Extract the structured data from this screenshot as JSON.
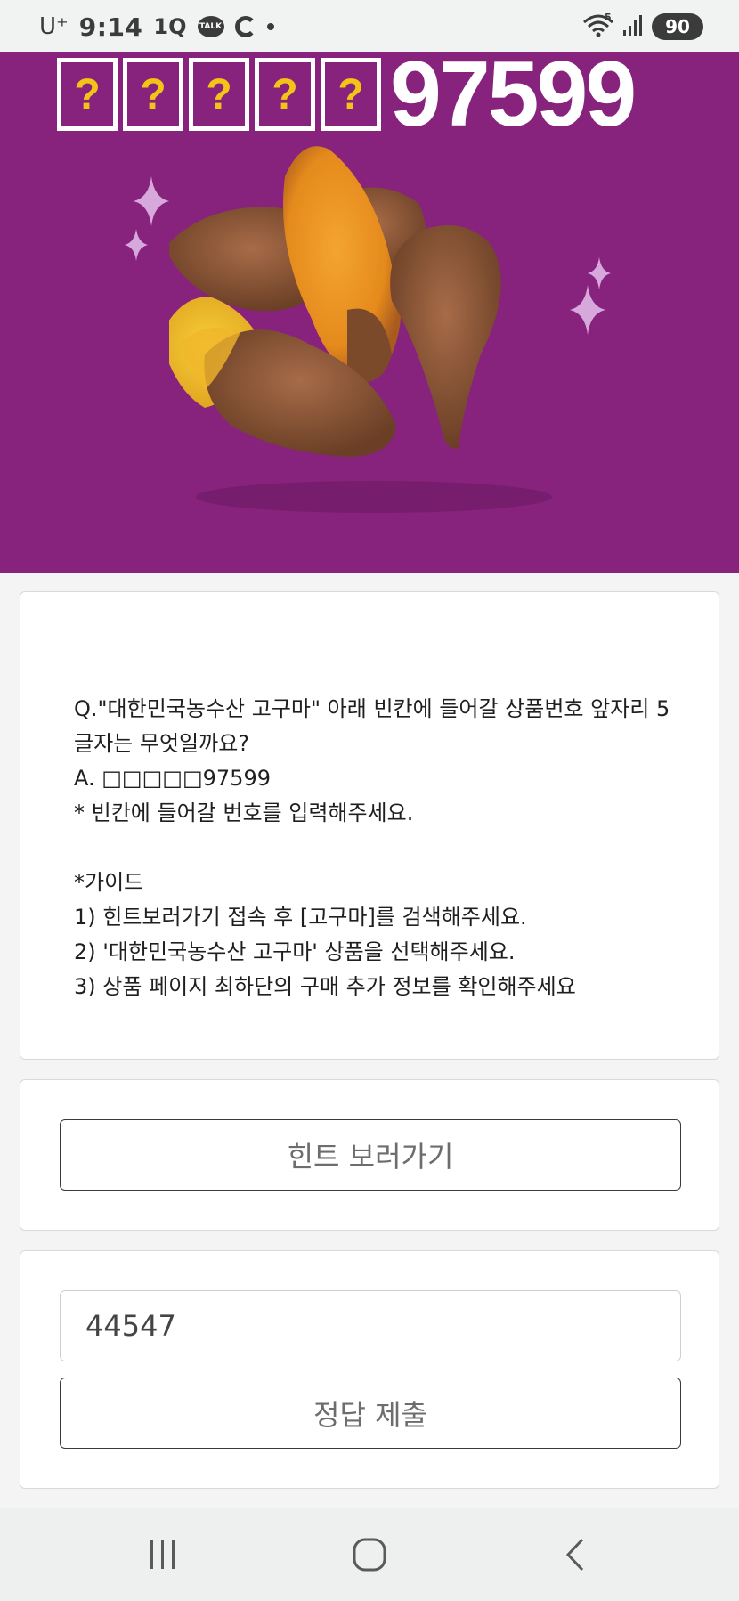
{
  "status_bar": {
    "carrier": "U⁺",
    "time": "9:14",
    "app_icon_1q": "1Q",
    "talk_badge": "TALK",
    "battery": "90",
    "network_label": "5",
    "icons": [
      "kakaotalk-icon",
      "c-app-icon",
      "notification-dot-icon",
      "wifi-icon",
      "signal-icon",
      "battery-icon"
    ]
  },
  "banner": {
    "hidden_digits": [
      "?",
      "?",
      "?",
      "?",
      "?"
    ],
    "code_suffix": "97599",
    "image": "roasted-sweet-potatoes",
    "background_color": "#87227d",
    "hidden_box_color": "#f3c417"
  },
  "question": {
    "lines": [
      "Q.\"대한민국농수산 고구마\" 아래 빈칸에 들어갈 상품번호 앞자리 5",
      "글자는 무엇일까요?",
      "A. □□□□□97599",
      "* 빈칸에 들어갈 번호를 입력해주세요.",
      "",
      "*가이드",
      "1) 힌트보러가기 접속 후 [고구마]를 검색해주세요.",
      "2) '대한민국농수산 고구마' 상품을 선택해주세요.",
      "3) 상품 페이지 최하단의 구매 추가 정보를 확인해주세요"
    ]
  },
  "hint": {
    "button_label": "힌트 보러가기"
  },
  "answer": {
    "input_value": "44547",
    "submit_label": "정답 제출"
  },
  "nav_bar": {
    "icons": [
      "recent-apps-icon",
      "home-icon",
      "back-icon"
    ]
  }
}
